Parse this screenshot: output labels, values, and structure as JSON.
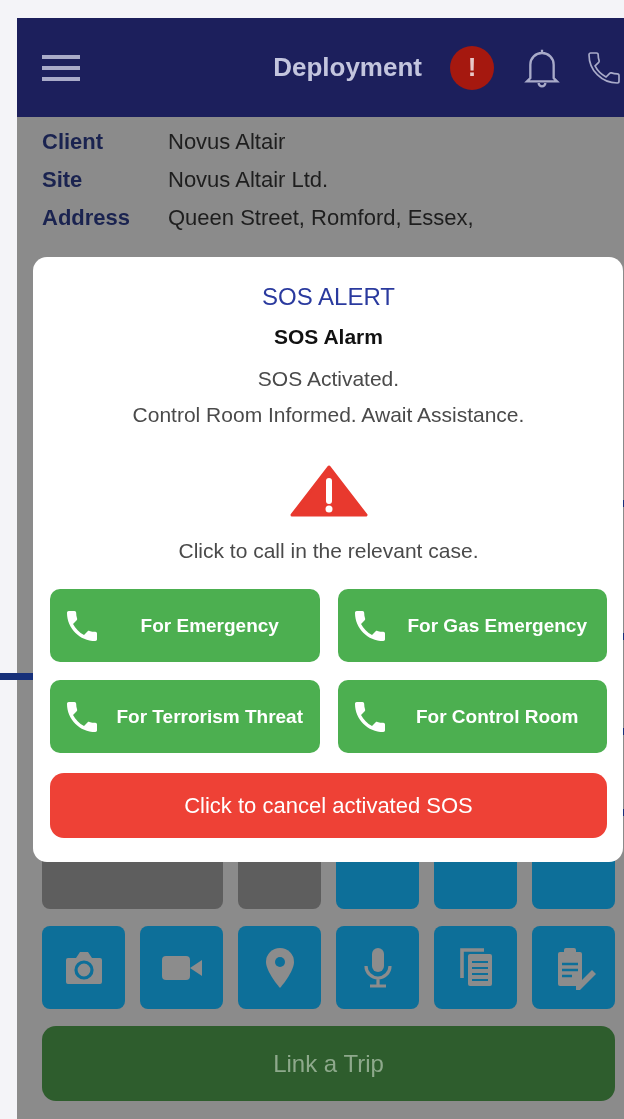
{
  "header": {
    "title": "Deployment",
    "alert_badge": "!"
  },
  "details": [
    {
      "label": "Client",
      "value": "Novus Altair"
    },
    {
      "label": "Site",
      "value": "Novus Altair Ltd."
    },
    {
      "label": "Address",
      "value": "Queen Street, Romford, Essex,"
    }
  ],
  "tiles_row_1": [
    {
      "disabled": true
    },
    {
      "disabled": true
    },
    {
      "disabled": false
    },
    {
      "disabled": false
    },
    {
      "disabled": false
    }
  ],
  "link_button": "Link a Trip",
  "dialog": {
    "title": "SOS ALERT",
    "subtitle": "SOS Alarm",
    "message": [
      "SOS Activated.",
      "Control Room Informed. Await Assistance."
    ],
    "instruction": "Click to call in the relevant case.",
    "call_buttons": [
      "For Emergency",
      "For Gas Emergency",
      "For Terrorism Threat",
      "For Control Room"
    ],
    "cancel_button": "Click to cancel activated SOS"
  }
}
